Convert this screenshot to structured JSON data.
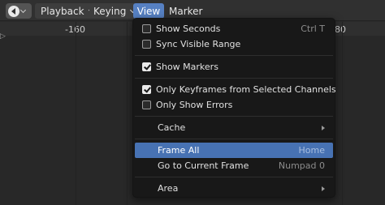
{
  "header": {
    "menus": [
      "Playback",
      "Keying",
      "View",
      "Marker"
    ],
    "active_menu": "View"
  },
  "ruler": {
    "labels": [
      "-160",
      "80"
    ]
  },
  "view_menu": {
    "items": {
      "show_seconds": {
        "label": "Show Seconds",
        "shortcut": "Ctrl T",
        "checked": false
      },
      "sync_visible_range": {
        "label": "Sync Visible Range",
        "checked": false
      },
      "show_markers": {
        "label": "Show Markers",
        "checked": true
      },
      "only_keyframes": {
        "label": "Only Keyframes from Selected Channels",
        "checked": true
      },
      "only_errors": {
        "label": "Only Show Errors",
        "checked": false
      },
      "cache": {
        "label": "Cache"
      },
      "frame_all": {
        "label": "Frame All",
        "shortcut": "Home"
      },
      "goto_current": {
        "label": "Go to Current Frame",
        "shortcut": "Numpad 0"
      },
      "area": {
        "label": "Area"
      }
    }
  },
  "colors": {
    "accent": "#4772b3",
    "active_menu": "#5680c2",
    "menu_bg": "#181818"
  }
}
